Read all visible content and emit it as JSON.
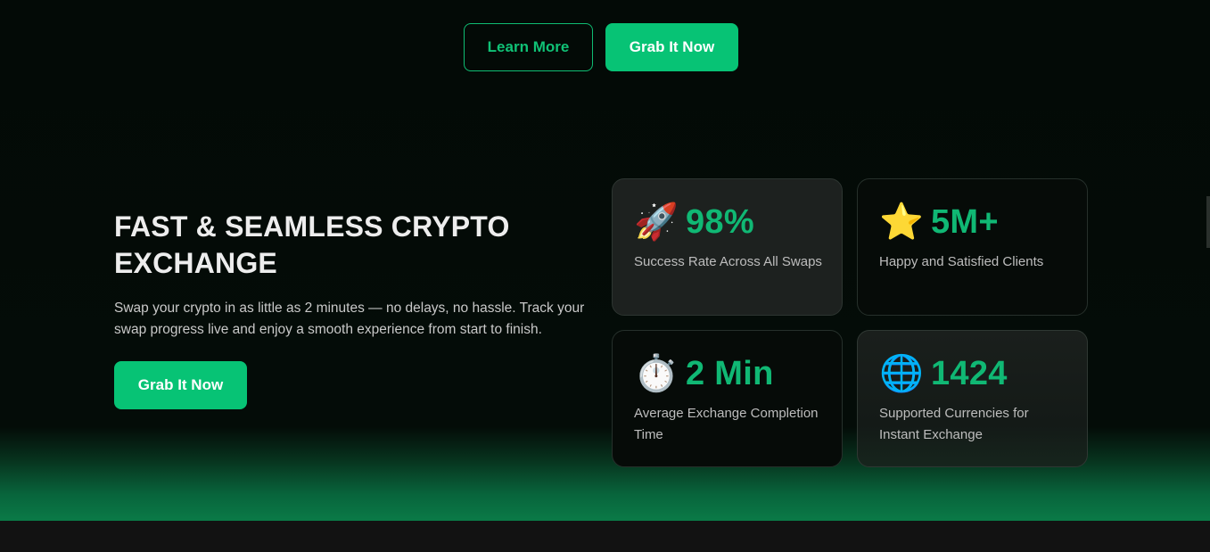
{
  "top_actions": {
    "learn_more_label": "Learn More",
    "grab_label": "Grab It Now"
  },
  "hero": {
    "headline": "FAST & SEAMLESS CRYPTO EXCHANGE",
    "description": "Swap your crypto in as little as 2 minutes — no delays, no hassle. Track your swap progress live and enjoy a smooth experience from start to finish.",
    "cta_label": "Grab It Now"
  },
  "stats": [
    {
      "icon": "rocket-icon",
      "emoji": "🚀",
      "value": "98%",
      "label": "Success Rate Across All Swaps"
    },
    {
      "icon": "star-icon",
      "emoji": "⭐",
      "value": "5M+",
      "label": "Happy and Satisfied Clients"
    },
    {
      "icon": "stopwatch-icon",
      "emoji": "⏱️",
      "value": "2 Min",
      "label": "Average Exchange Completion Time"
    },
    {
      "icon": "globe-icon",
      "emoji": "🌐",
      "value": "1424",
      "label": "Supported Currencies for Instant Exchange"
    }
  ],
  "colors": {
    "accent": "#07c375",
    "stat_value": "#10b874",
    "background": "#030a06"
  }
}
